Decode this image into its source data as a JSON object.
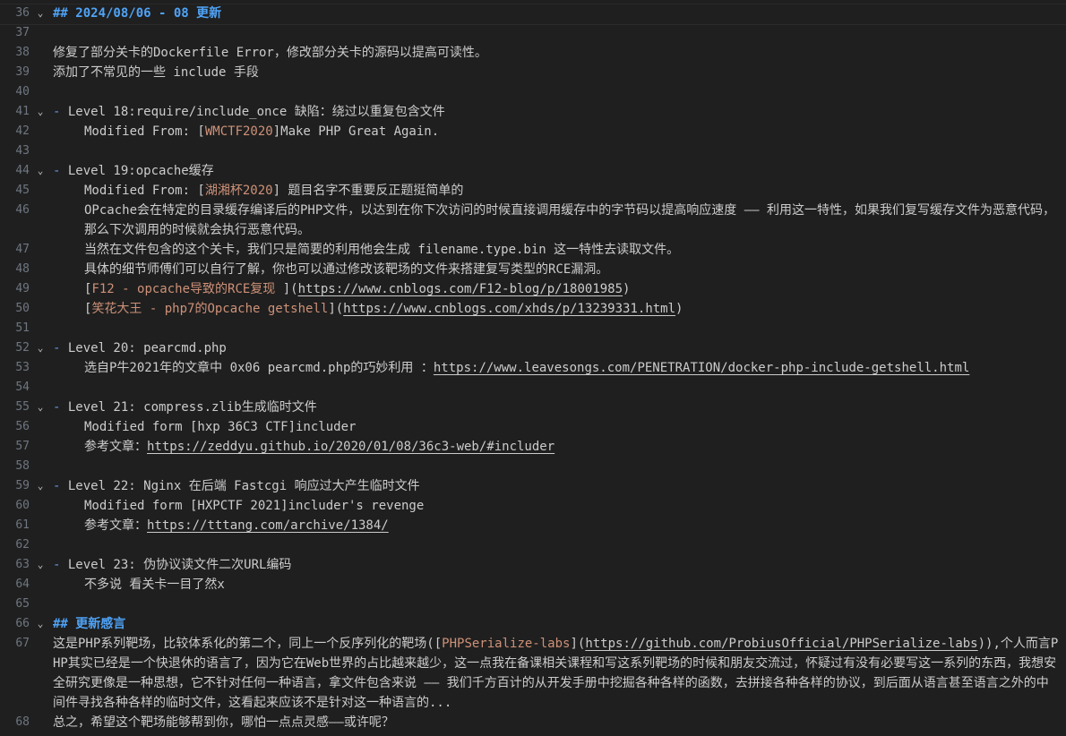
{
  "lines": [
    {
      "n": "36",
      "fold": true,
      "heading": "## 2024/08/06 - 08 更新"
    },
    {
      "n": "37"
    },
    {
      "n": "38",
      "text": "修复了部分关卡的Dockerfile Error，修改部分关卡的源码以提高可读性。"
    },
    {
      "n": "39",
      "text": "添加了不常见的一些 include 手段"
    },
    {
      "n": "40"
    },
    {
      "n": "41",
      "fold": true,
      "dash": "- ",
      "text": "Level 18:require/include_once 缺陷：绕过以重复包含文件"
    },
    {
      "n": "42",
      "indent": true,
      "pre": "Modified From: [",
      "link": "WMCTF2020",
      "post": "]Make PHP Great Again."
    },
    {
      "n": "43"
    },
    {
      "n": "44",
      "fold": true,
      "dash": "- ",
      "text": "Level 19:opcache缓存"
    },
    {
      "n": "45",
      "indent": true,
      "pre": "Modified From: [",
      "link": "湖湘杯2020",
      "post": "] 题目名字不重要反正题挺简单的"
    },
    {
      "n": "46",
      "indent": true,
      "text": "OPcache会在特定的目录缓存编译后的PHP文件，以达到在你下次访问的时候直接调用缓存中的字节码以提高响应速度 —— 利用这一特性，如果我们复写缓存文件为恶意代码，那么下次调用的时候就会执行恶意代码。"
    },
    {
      "n": "47",
      "indent": true,
      "text": "当然在文件包含的这个关卡，我们只是简要的利用他会生成 filename.type.bin 这一特性去读取文件。"
    },
    {
      "n": "48",
      "indent": true,
      "text": "具体的细节师傅们可以自行了解，你也可以通过修改该靶场的文件来搭建复写类型的RCE漏洞。"
    },
    {
      "n": "49",
      "indent": true,
      "pre": "[",
      "link": "F12 - opcache导致的RCE复现 ",
      "post": "](",
      "url": "https://www.cnblogs.com/F12-blog/p/18001985",
      "tail": ")"
    },
    {
      "n": "50",
      "indent": true,
      "pre": "[",
      "link": "笑花大王 - php7的Opcache getshell",
      "post": "](",
      "url": "https://www.cnblogs.com/xhds/p/13239331.html",
      "tail": ")"
    },
    {
      "n": "51"
    },
    {
      "n": "52",
      "fold": true,
      "dash": "- ",
      "text": "Level 20: pearcmd.php"
    },
    {
      "n": "53",
      "indent": true,
      "pre": "选自P牛2021年的文章中 0x06 pearcmd.php的巧妙利用 ：",
      "url": "https://www.leavesongs.com/PENETRATION/docker-php-include-getshell.html"
    },
    {
      "n": "54"
    },
    {
      "n": "55",
      "fold": true,
      "dash": "- ",
      "text": "Level 21: compress.zlib生成临时文件"
    },
    {
      "n": "56",
      "indent": true,
      "text": "Modified form [hxp 36C3 CTF]includer"
    },
    {
      "n": "57",
      "indent": true,
      "pre": "参考文章：",
      "url": "https://zeddyu.github.io/2020/01/08/36c3-web/#includer"
    },
    {
      "n": "58"
    },
    {
      "n": "59",
      "fold": true,
      "dash": "- ",
      "text": "Level 22: Nginx 在后端 Fastcgi 响应过大产生临时文件"
    },
    {
      "n": "60",
      "indent": true,
      "text": "Modified form [HXPCTF 2021]includer's revenge"
    },
    {
      "n": "61",
      "indent": true,
      "pre": "参考文章：",
      "url": "https://tttang.com/archive/1384/"
    },
    {
      "n": "62"
    },
    {
      "n": "63",
      "fold": true,
      "dash": "- ",
      "text": "Level 23: 伪协议读文件二次URL编码"
    },
    {
      "n": "64",
      "indent": true,
      "text": "不多说 看关卡一目了然x"
    },
    {
      "n": "65"
    },
    {
      "n": "66",
      "fold": true,
      "heading": "## 更新感言"
    },
    {
      "n": "67",
      "pre": "这是PHP系列靶场，比较体系化的第二个，同上一个反序列化的靶场([",
      "link": "PHPSerialize-labs",
      "post": "](",
      "url": "https://github.com/ProbiusOfficial/PHPSerialize-labs",
      "tail": ")),个人而言PHP其实已经是一个快退休的语言了，因为它在Web世界的占比越来越少，这一点我在备课相关课程和写这系列靶场的时候和朋友交流过，怀疑过有没有必要写这一系列的东西，我想安全研究更像是一种思想，它不针对任何一种语言，拿文件包含来说 —— 我们千方百计的从开发手册中挖掘各种各样的函数，去拼接各种各样的协议，到后面从语言甚至语言之外的中间件寻找各种各样的临时文件，这看起来应该不是针对这一种语言的..."
    },
    {
      "n": "68",
      "text": "总之，希望这个靶场能够帮到你，哪怕一点点灵感——或许呢？"
    }
  ]
}
